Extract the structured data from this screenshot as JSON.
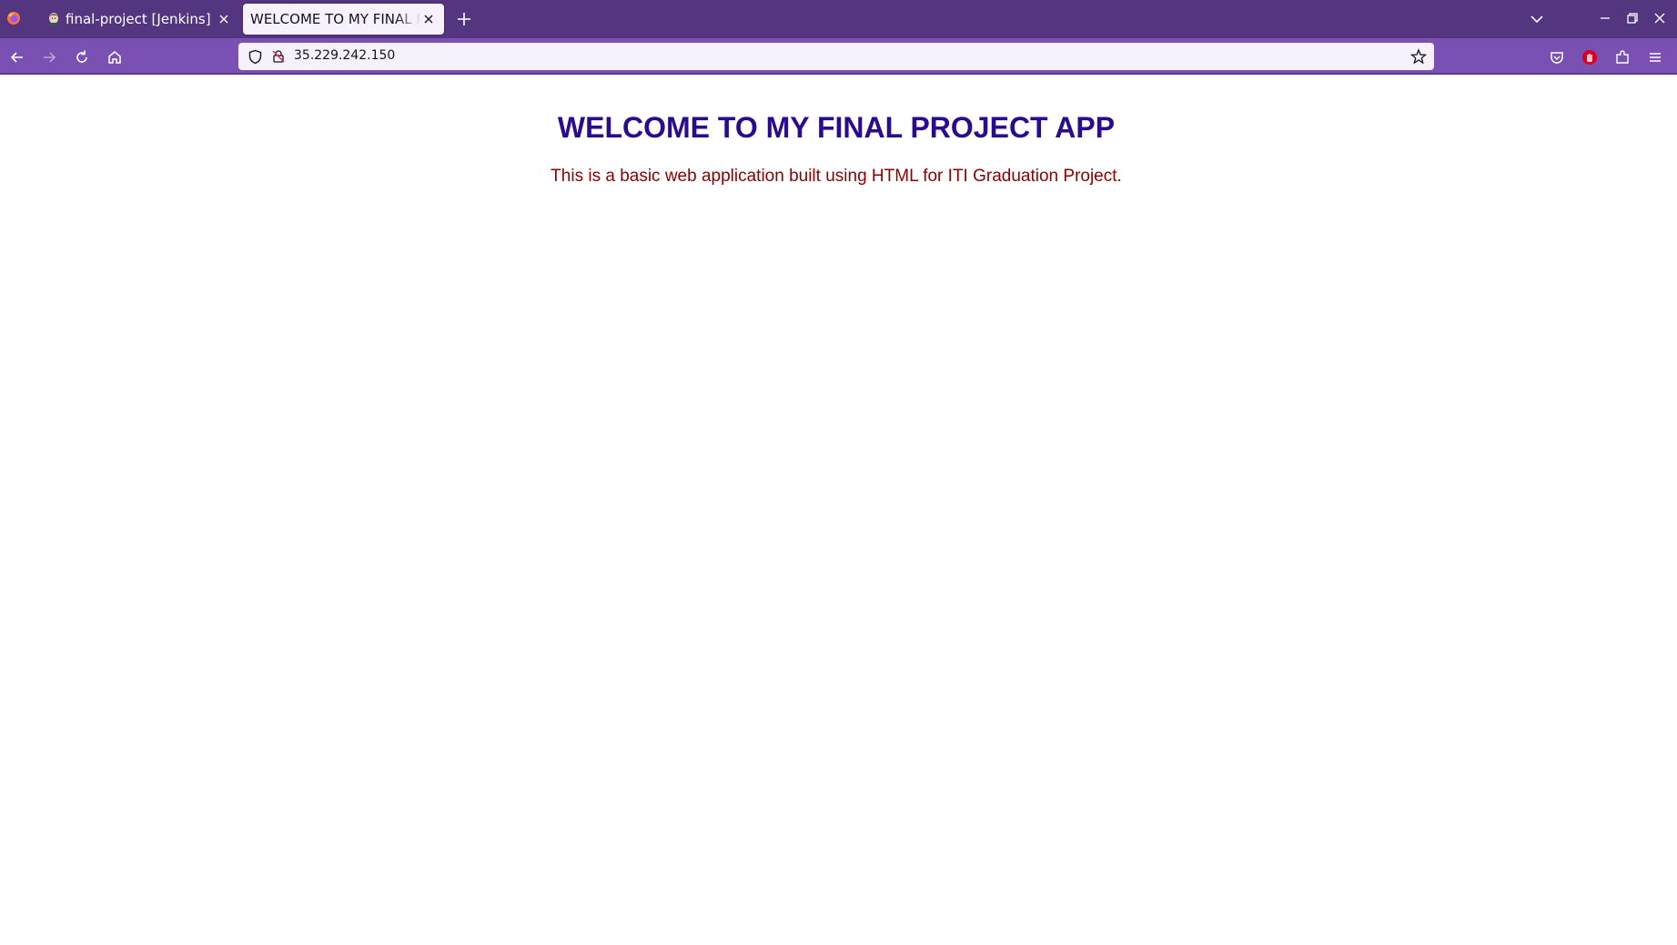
{
  "browser": {
    "tabs": [
      {
        "title": "final-project [Jenkins]",
        "active": false,
        "favicon": "jenkins-butler-icon"
      },
      {
        "title": "WELCOME TO MY FINAL PROJECT APP",
        "active": true,
        "favicon": ""
      }
    ],
    "url": "35.229.242.150",
    "colors": {
      "tabbar": "#54357f",
      "navbar": "#7a50b3",
      "urlbar": "#f6f1fa"
    }
  },
  "page": {
    "title": "WELCOME TO MY FINAL PROJECT APP",
    "description": "This is a basic web application built using HTML for ITI Graduation Project.",
    "title_color": "#2a0a8e",
    "description_color": "#8b0000"
  }
}
